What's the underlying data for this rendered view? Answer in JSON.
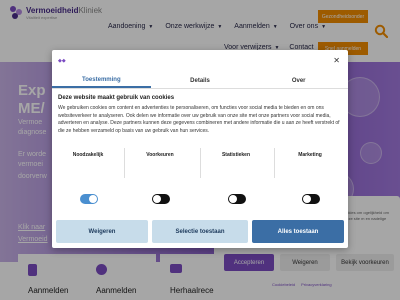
{
  "header": {
    "logo_brand": "Vermoeidheid",
    "logo_brand_light": "Kliniek",
    "logo_tagline": "Vitaliteit  expertise",
    "nav_primary": [
      {
        "label": "Aandoening",
        "dropdown": true
      },
      {
        "label": "Onze werkwijze",
        "dropdown": true
      },
      {
        "label": "Aanmelden",
        "dropdown": true
      },
      {
        "label": "Over ons",
        "dropdown": true
      }
    ],
    "nav_secondary": [
      {
        "label": "Voor verwijzers",
        "dropdown": true
      },
      {
        "label": "Contact",
        "dropdown": false
      }
    ],
    "btn_top": "Gezondheidsonder",
    "btn_bottom": "Snel aanmelden",
    "accent": "#f28c00",
    "search_icon": "search-icon"
  },
  "hero": {
    "title_line1": "Exp",
    "title_line2": "ME/",
    "text_line1": "Vermoe",
    "text_line2": "diagnose",
    "text_line3": "Er worde",
    "text_line4": "vermoei",
    "text_line5": "doorverw",
    "link_line1": "Klik naar",
    "link_line2": "Vermoeid"
  },
  "cards": [
    {
      "label": "Aanmelden",
      "icon": "clipboard-icon"
    },
    {
      "label": "Aanmelden",
      "icon": "info-icon"
    },
    {
      "label": "Herhaalrecept",
      "icon": "prescription-icon"
    }
  ],
  "mini_panel": {
    "text": "ookies om ogelijkheid om deze site m en nadelige",
    "accept": "Accepteren",
    "deny": "Weigeren",
    "prefs": "Bekijk voorkeuren",
    "link_cookie": "Cookiebeleid",
    "link_privacy": "Privacyverklaring"
  },
  "modal": {
    "close_icon": "close-icon",
    "tabs": [
      "Toestemming",
      "Details",
      "Over"
    ],
    "active_tab": "Toestemming",
    "heading": "Deze website maakt gebruik van cookies",
    "body": "We gebruiken cookies om content en advertenties te personaliseren, om functies voor social media te bieden en om ons websiteverkeer te analyseren. Ook delen we informatie over uw gebruik van onze site met onze partners voor social media, adverteren en analyse. Deze partners kunnen deze gegevens combineren met andere informatie die u aan ze heeft verstrekt of die ze hebben verzameld op basis van uw gebruik van hun services.",
    "categories": [
      {
        "label": "Noodzakelijk",
        "on": true
      },
      {
        "label": "Voorkeuren",
        "on": false
      },
      {
        "label": "Statistieken",
        "on": false
      },
      {
        "label": "Marketing",
        "on": false
      }
    ],
    "btn_deny": "Weigeren",
    "btn_select": "Selectie toestaan",
    "btn_allow": "Alles toestaan",
    "colors": {
      "primary": "#3b6ea5",
      "light_btn": "#c7dcea",
      "toggle_on": "#4a8fd0"
    }
  }
}
